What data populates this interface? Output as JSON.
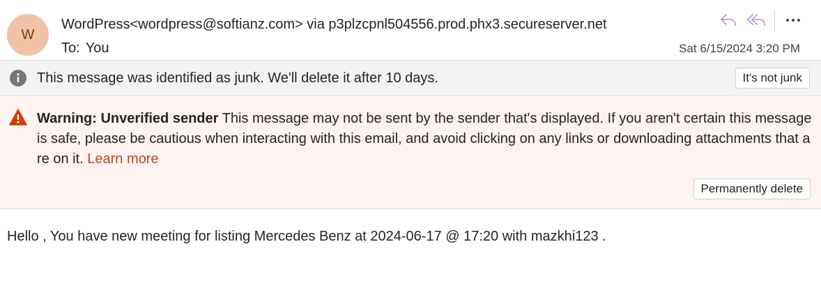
{
  "header": {
    "avatar_initial": "W",
    "from": "WordPress<wordpress@softianz.com> via p3plzcpnl504556.prod.phx3.secureserver.net",
    "to_label": "To:",
    "to_value": "You",
    "date": "Sat 6/15/2024 3:20 PM",
    "actions": [
      "reply-icon",
      "reply-all-icon",
      "more-icon"
    ]
  },
  "junk": {
    "icon": "info-icon",
    "message": "This message was identified as junk. We'll delete it after 10 days.",
    "button_label": "It's not junk"
  },
  "warning": {
    "icon": "warning-icon",
    "title": "Warning: Unverified sender",
    "message": " This message may not be sent by the sender that's displayed. If you aren't certain this message is safe, please be cautious when interacting with this email, and avoid clicking on any links or downloading attachments that are on it. ",
    "link_label": "Learn more",
    "button_label": "Permanently delete"
  },
  "body": {
    "text": "Hello , You have new meeting for listing Mercedes Benz at  2024-06-17 @ 17:20 with mazkhi123 ."
  },
  "colors": {
    "avatar_bg": "#f1c3a6",
    "avatar_text": "#7a3b14",
    "action_icon": "#c9a2d9",
    "warning_bg": "#fdf3f0",
    "warning_icon": "#d83b01",
    "link": "#c4431f",
    "junk_bg": "#f3f3f3"
  }
}
